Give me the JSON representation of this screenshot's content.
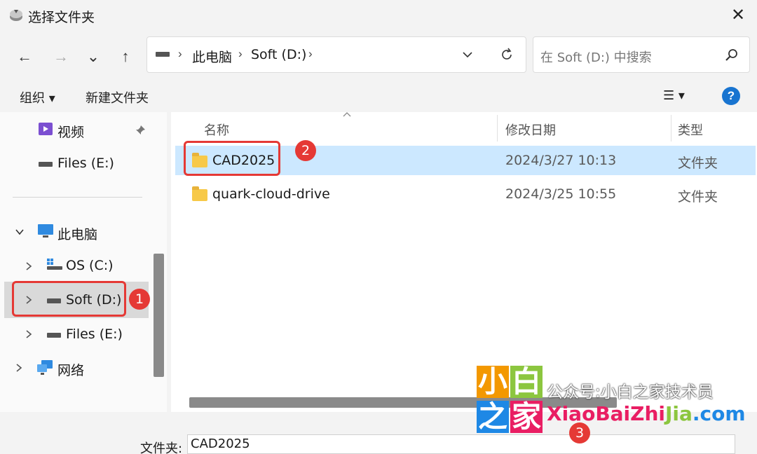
{
  "window": {
    "title": "选择文件夹",
    "close": "✕"
  },
  "nav": {
    "back": "←",
    "forward": "→",
    "recent": "⌄",
    "up": "↑"
  },
  "address": {
    "crumbs": [
      "此电脑",
      "Soft (D:)"
    ],
    "sep": "›"
  },
  "search": {
    "placeholder": "在 Soft (D:) 中搜索"
  },
  "toolbar": {
    "organize": "组织 ▾",
    "new_folder": "新建文件夹",
    "view": "☰ ▾",
    "help": "?"
  },
  "sidebar": {
    "items": [
      {
        "label": "视频",
        "icon": "video-icon"
      },
      {
        "label": "Files (E:)",
        "icon": "drive-icon"
      },
      {
        "label": "此电脑",
        "icon": "computer-icon"
      },
      {
        "label": "OS (C:)",
        "icon": "windows-drive-icon"
      },
      {
        "label": "Soft (D:)",
        "icon": "drive-icon"
      },
      {
        "label": "Files (E:)",
        "icon": "drive-icon"
      },
      {
        "label": "网络",
        "icon": "network-icon"
      }
    ]
  },
  "list": {
    "headers": [
      "名称",
      "修改日期",
      "类型"
    ],
    "rows": [
      {
        "name": "CAD2025",
        "date": "2024/3/27 10:13",
        "type": "文件夹"
      },
      {
        "name": "quark-cloud-drive",
        "date": "2024/3/25 10:55",
        "type": "文件夹"
      }
    ]
  },
  "footer": {
    "label": "文件夹:",
    "value": "CAD2025"
  },
  "annotations": [
    "1",
    "2",
    "3"
  ],
  "watermark": {
    "chars": [
      "小",
      "白",
      "之",
      "家"
    ],
    "line1": "公众号:小白之家技术员",
    "line2_a": "XiaoBaiZhi",
    "line2_b": "Jia",
    "line2_c": ".com"
  },
  "colors": {
    "accent": "#1874d0",
    "selection": "#cce8ff",
    "annotation": "#e53935"
  }
}
